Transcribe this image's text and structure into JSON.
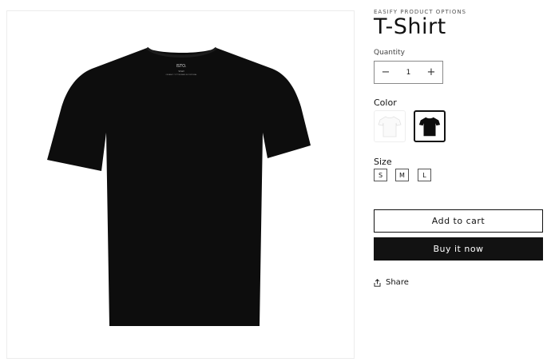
{
  "product": {
    "vendor": "EASIFY PRODUCT OPTIONS",
    "title": "T-Shirt",
    "image": {
      "alt_icon": "black-tshirt-product-image",
      "label_brand": "ISTO.",
      "label_line": "Small",
      "label_fine": "ORGANIC COTTON MADE IN PORTUGAL"
    }
  },
  "quantity": {
    "label": "Quantity",
    "value": "1",
    "minus": "−",
    "plus": "+"
  },
  "color": {
    "label": "Color",
    "options": [
      {
        "name": "White",
        "hex": "#ffffff",
        "selected": false
      },
      {
        "name": "Black",
        "hex": "#121212",
        "selected": true
      }
    ]
  },
  "size": {
    "label": "Size",
    "options": [
      "S",
      "M",
      "L"
    ]
  },
  "buttons": {
    "add_to_cart": "Add to cart",
    "buy_now": "Buy it now"
  },
  "share": {
    "label": "Share",
    "icon": "share-icon"
  },
  "colors": {
    "text": "#121212",
    "border": "#8a8a8a",
    "button_dark": "#121212"
  }
}
